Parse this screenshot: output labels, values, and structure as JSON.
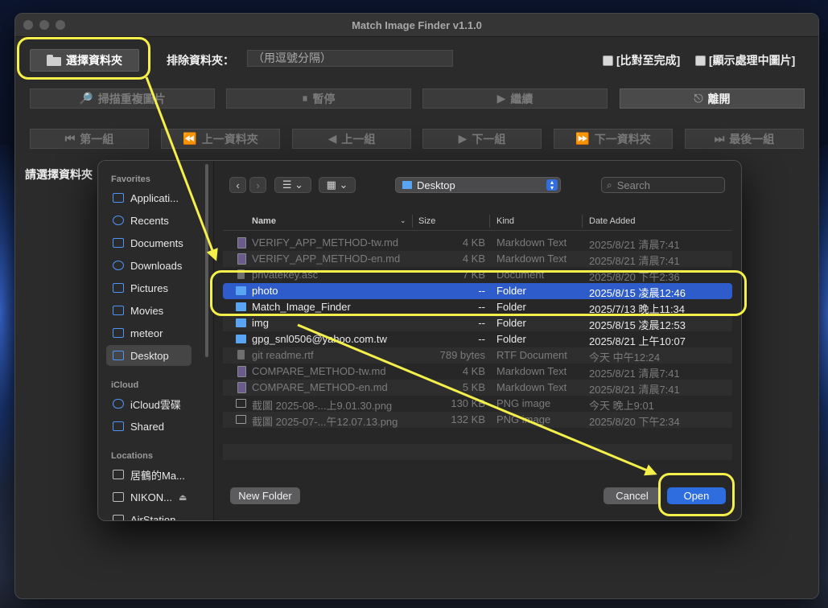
{
  "app": {
    "title": "Match Image Finder v1.1.0",
    "choose_folder": "選擇資料夾",
    "exclude_label": "排除資料夾：",
    "exclude_placeholder": "（用逗號分隔）",
    "check_complete": "[比對至完成]",
    "check_show": "[顯示處理中圖片]",
    "toolbar": [
      {
        "label": "掃描重複圖片",
        "icon": "magnifier-icon",
        "enabled": false
      },
      {
        "label": "暫停",
        "icon": "pause-icon",
        "enabled": false
      },
      {
        "label": "繼續",
        "icon": "play-icon",
        "enabled": false
      },
      {
        "label": "離開",
        "icon": "exit-icon",
        "enabled": true
      }
    ],
    "nav": [
      {
        "label": "第一組",
        "icon": "⏮"
      },
      {
        "label": "上一資料夾",
        "icon": "⏪"
      },
      {
        "label": "上一組",
        "icon": "◀"
      },
      {
        "label": "下一組",
        "icon": "▶"
      },
      {
        "label": "下一資料夾",
        "icon": "⏩"
      },
      {
        "label": "最後一組",
        "icon": "⏭"
      }
    ],
    "prompt": "請選擇資料夾"
  },
  "dialog": {
    "sidebar": {
      "favorites_title": "Favorites",
      "favorites": [
        "Applicati...",
        "Recents",
        "Documents",
        "Downloads",
        "Pictures",
        "Movies",
        "meteor",
        "Desktop"
      ],
      "icloud_title": "iCloud",
      "icloud": [
        "iCloud雲碟",
        "Shared"
      ],
      "locations_title": "Locations",
      "locations": [
        "居鶴的Ma...",
        "NIKON...",
        "AirStation"
      ]
    },
    "location": "Desktop",
    "search_placeholder": "Search",
    "columns": {
      "name": "Name",
      "size": "Size",
      "kind": "Kind",
      "date": "Date Added"
    },
    "files": [
      {
        "name": "VERIFY_APP_METHOD-tw.md",
        "size": "4 KB",
        "kind": "Markdown Text",
        "date": "2025/8/21 清晨7:41",
        "type": "doc",
        "enabled": false
      },
      {
        "name": "VERIFY_APP_METHOD-en.md",
        "size": "4 KB",
        "kind": "Markdown Text",
        "date": "2025/8/21 清晨7:41",
        "type": "doc",
        "enabled": false
      },
      {
        "name": "privatekey.asc",
        "size": "7 KB",
        "kind": "Document",
        "date": "2025/8/20 下午2:36",
        "type": "plain",
        "enabled": false
      },
      {
        "name": "photo",
        "size": "--",
        "kind": "Folder",
        "date": "2025/8/15 凌晨12:46",
        "type": "fold",
        "enabled": true,
        "selected": true
      },
      {
        "name": "Match_Image_Finder",
        "size": "--",
        "kind": "Folder",
        "date": "2025/7/13 晚上11:34",
        "type": "fold",
        "enabled": true
      },
      {
        "name": "img",
        "size": "--",
        "kind": "Folder",
        "date": "2025/8/15 凌晨12:53",
        "type": "fold",
        "enabled": true
      },
      {
        "name": "gpg_snl0506@yahoo.com.tw",
        "size": "--",
        "kind": "Folder",
        "date": "2025/8/21 上午10:07",
        "type": "fold",
        "enabled": true
      },
      {
        "name": "git readme.rtf",
        "size": "789 bytes",
        "kind": "RTF Document",
        "date": "今天 中午12:24",
        "type": "plain",
        "enabled": false
      },
      {
        "name": "COMPARE_METHOD-tw.md",
        "size": "4 KB",
        "kind": "Markdown Text",
        "date": "2025/8/21 清晨7:41",
        "type": "doc",
        "enabled": false
      },
      {
        "name": "COMPARE_METHOD-en.md",
        "size": "5 KB",
        "kind": "Markdown Text",
        "date": "2025/8/21 清晨7:41",
        "type": "doc",
        "enabled": false
      },
      {
        "name": "截圖 2025-08-...上9.01.30.png",
        "size": "130 KB",
        "kind": "PNG image",
        "date": "今天 晚上9:01",
        "type": "img",
        "enabled": false
      },
      {
        "name": "截圖 2025-07-...午12.07.13.png",
        "size": "132 KB",
        "kind": "PNG image",
        "date": "2025/8/20 下午2:34",
        "type": "img",
        "enabled": false
      }
    ],
    "new_folder": "New Folder",
    "cancel": "Cancel",
    "open": "Open"
  },
  "colors": {
    "highlight": "#f4ef4a",
    "accent": "#2d6de0",
    "selection": "#2f5ccb"
  }
}
